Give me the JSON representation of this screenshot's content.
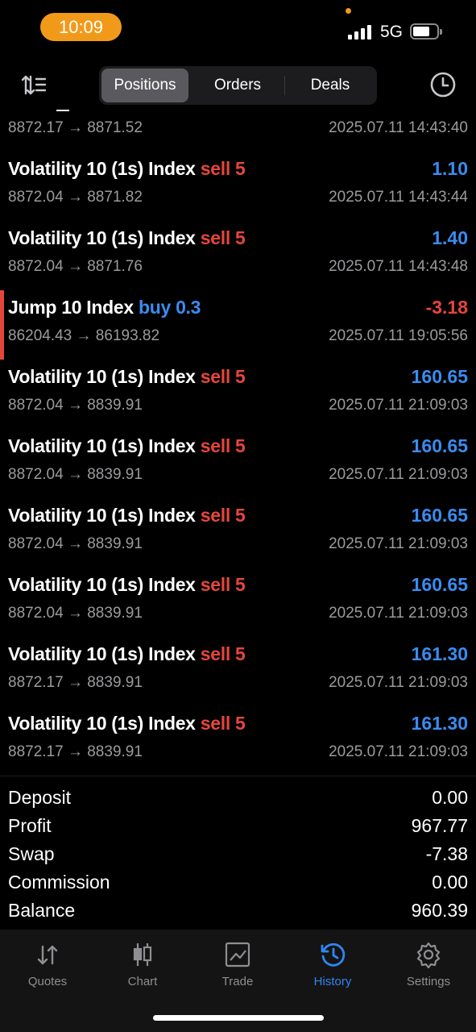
{
  "status_bar": {
    "time": "10:09",
    "network": "5G"
  },
  "toolbar": {
    "tabs": [
      {
        "label": "Positions",
        "active": true
      },
      {
        "label": "Orders",
        "active": false
      },
      {
        "label": "Deals",
        "active": false
      }
    ]
  },
  "partial_deal": {
    "prices": "8872.17 → 8871.52",
    "datetime": "2025.07.11 14:43:40"
  },
  "deals": [
    {
      "symbol": "Volatility 10 (1s) Index",
      "side": "sell 5",
      "profit": "1.10",
      "prices": "8872.04 → 8871.82",
      "datetime": "2025.07.11 14:43:44"
    },
    {
      "symbol": "Volatility 10 (1s) Index",
      "side": "sell 5",
      "profit": "1.40",
      "prices": "8872.04 → 8871.76",
      "datetime": "2025.07.11 14:43:48"
    },
    {
      "symbol": "Jump 10 Index",
      "side": "buy 0.3",
      "profit": "-3.18",
      "prices": "86204.43 → 86193.82",
      "datetime": "2025.07.11 19:05:56"
    },
    {
      "symbol": "Volatility 10 (1s) Index",
      "side": "sell 5",
      "profit": "160.65",
      "prices": "8872.04 → 8839.91",
      "datetime": "2025.07.11 21:09:03"
    },
    {
      "symbol": "Volatility 10 (1s) Index",
      "side": "sell 5",
      "profit": "160.65",
      "prices": "8872.04 → 8839.91",
      "datetime": "2025.07.11 21:09:03"
    },
    {
      "symbol": "Volatility 10 (1s) Index",
      "side": "sell 5",
      "profit": "160.65",
      "prices": "8872.04 → 8839.91",
      "datetime": "2025.07.11 21:09:03"
    },
    {
      "symbol": "Volatility 10 (1s) Index",
      "side": "sell 5",
      "profit": "160.65",
      "prices": "8872.04 → 8839.91",
      "datetime": "2025.07.11 21:09:03"
    },
    {
      "symbol": "Volatility 10 (1s) Index",
      "side": "sell 5",
      "profit": "161.30",
      "prices": "8872.17 → 8839.91",
      "datetime": "2025.07.11 21:09:03"
    },
    {
      "symbol": "Volatility 10 (1s) Index",
      "side": "sell 5",
      "profit": "161.30",
      "prices": "8872.17 → 8839.91",
      "datetime": "2025.07.11 21:09:03"
    }
  ],
  "summary": [
    {
      "label": "Deposit",
      "value": "0.00"
    },
    {
      "label": "Profit",
      "value": "967.77"
    },
    {
      "label": "Swap",
      "value": "-7.38"
    },
    {
      "label": "Commission",
      "value": "0.00"
    },
    {
      "label": "Balance",
      "value": "960.39"
    }
  ],
  "tabbar": [
    {
      "label": "Quotes",
      "icon": "quotes-arrows-icon",
      "active": false
    },
    {
      "label": "Chart",
      "icon": "candlestick-icon",
      "active": false
    },
    {
      "label": "Trade",
      "icon": "trade-chart-icon",
      "active": false
    },
    {
      "label": "History",
      "icon": "history-clock-icon",
      "active": true
    },
    {
      "label": "Settings",
      "icon": "gear-icon",
      "active": false
    }
  ],
  "colors": {
    "sell": "#e5463c",
    "buy": "#3a8cf0",
    "profit_positive": "#3a8cf0",
    "profit_negative": "#e5463c",
    "active_tab": "#2f86f2",
    "time_pill": "#f19a1a"
  }
}
